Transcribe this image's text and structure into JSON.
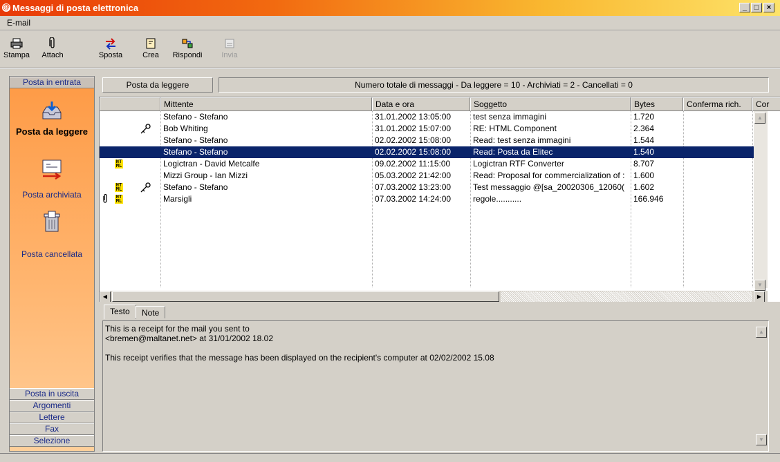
{
  "window": {
    "title": "Messaggi di posta elettronica",
    "controls": [
      "_",
      "□",
      "×"
    ]
  },
  "menu": {
    "items": [
      "E-mail"
    ]
  },
  "toolbar": {
    "buttons": [
      {
        "label": "Stampa",
        "icon": "printer-icon",
        "enabled": true
      },
      {
        "label": "Attach",
        "icon": "paperclip-icon",
        "enabled": true
      },
      {
        "label": "Sposta",
        "icon": "move-arrows-icon",
        "enabled": true
      },
      {
        "label": "Crea",
        "icon": "new-message-icon",
        "enabled": true
      },
      {
        "label": "Rispondi",
        "icon": "reply-icon",
        "enabled": true
      },
      {
        "label": "Invia",
        "icon": "send-icon",
        "enabled": false
      }
    ]
  },
  "sidebar": {
    "top_button": "Posta in entrata",
    "folders": [
      {
        "label": "Posta da leggere",
        "icon": "inbox-tray-icon",
        "active": true
      },
      {
        "label": "Posta archiviata",
        "icon": "archive-icon",
        "active": false
      },
      {
        "label": "Posta cancellata",
        "icon": "trash-can-icon",
        "active": false
      }
    ],
    "bottom_buttons": [
      "Posta in uscita",
      "Argomenti",
      "Lettere",
      "Fax",
      "Selezione"
    ]
  },
  "header": {
    "current_folder": "Posta da leggere",
    "counts": "Numero totale di messaggi  -  Da leggere = 10  -  Archiviati = 2  -  Cancellati = 0"
  },
  "list": {
    "columns": [
      "",
      "Mittente",
      "Data e ora",
      "Soggetto",
      "Bytes",
      "Conferma rich.",
      "Cor"
    ],
    "rows": [
      {
        "attach": false,
        "html": false,
        "receipt": false,
        "sender": "Stefano - Stefano",
        "date": "31.01.2002  13:05:00",
        "subject": "test senza immagini",
        "bytes": "1.720",
        "selected": false
      },
      {
        "attach": false,
        "html": false,
        "receipt": true,
        "sender": "Bob Whiting",
        "date": "31.01.2002  15:07:00",
        "subject": "RE: HTML Component",
        "bytes": "2.364",
        "selected": false
      },
      {
        "attach": false,
        "html": false,
        "receipt": false,
        "sender": "Stefano - Stefano",
        "date": "02.02.2002  15:08:00",
        "subject": "Read: test senza immagini",
        "bytes": "1.544",
        "selected": false
      },
      {
        "attach": false,
        "html": false,
        "receipt": false,
        "sender": "Stefano - Stefano",
        "date": "02.02.2002  15:08:00",
        "subject": "Read: Posta da Elitec",
        "bytes": "1.540",
        "selected": true
      },
      {
        "attach": false,
        "html": true,
        "receipt": false,
        "sender": "Logictran - David Metcalfe",
        "date": "09.02.2002  11:15:00",
        "subject": "Logictran RTF Converter",
        "bytes": "8.707",
        "selected": false
      },
      {
        "attach": false,
        "html": false,
        "receipt": false,
        "sender": "Mizzi Group - Ian  Mizzi",
        "date": "05.03.2002  21:42:00",
        "subject": "Read: Proposal for commercialization of :",
        "bytes": "1.600",
        "selected": false
      },
      {
        "attach": false,
        "html": true,
        "receipt": true,
        "sender": "Stefano - Stefano",
        "date": "07.03.2002  13:23:00",
        "subject": "Test messaggio @[sa_20020306_12060(",
        "bytes": "1.602",
        "selected": false
      },
      {
        "attach": true,
        "html": true,
        "receipt": false,
        "sender": "Marsigli",
        "date": "07.03.2002  14:24:00",
        "subject": "regole...........",
        "bytes": "166.946",
        "selected": false
      }
    ],
    "html_badge": "HT ML"
  },
  "tabs": [
    {
      "label": "Testo",
      "active": true
    },
    {
      "label": "Note",
      "active": false
    }
  ],
  "preview": {
    "lines": [
      "This is a receipt for the mail you sent to",
      "<bremen@maltanet.net> at 31/01/2002 18.02",
      "",
      "This receipt verifies that the message has been displayed on the recipient's computer at 02/02/2002 15.08"
    ]
  },
  "colors": {
    "title_start": "#e83a08",
    "title_end": "#fde36a",
    "sidebar": "#fe9a45",
    "selection": "#0a246a",
    "html_badge": "#ffe300"
  }
}
